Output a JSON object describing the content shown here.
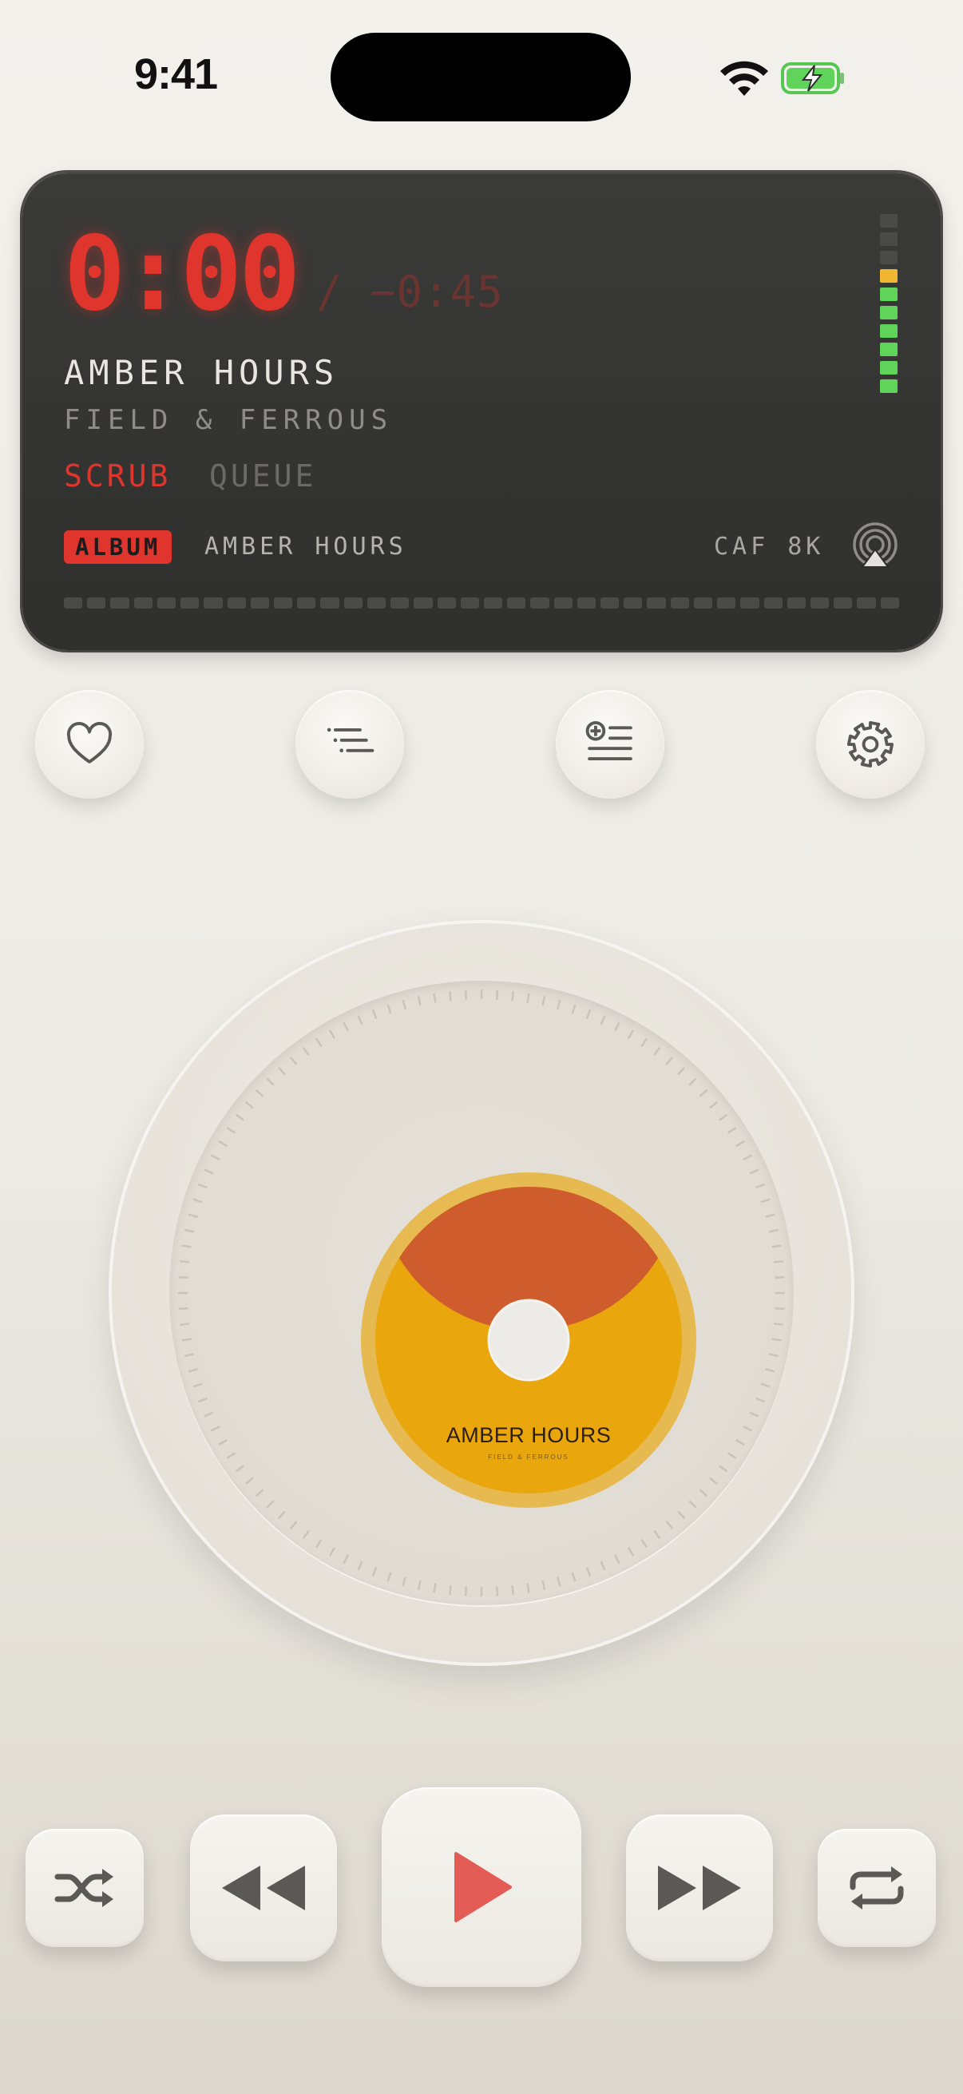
{
  "status_bar": {
    "time": "9:41",
    "wifi_icon": "wifi-icon",
    "battery_icon": "battery-charging-icon"
  },
  "display": {
    "elapsed": "0:00",
    "remaining": "/ −0:45",
    "track_title": "AMBER HOURS",
    "artist": "FIELD & FERROUS",
    "tabs": [
      {
        "label": "SCRUB",
        "active": true
      },
      {
        "label": "QUEUE",
        "active": false
      }
    ],
    "badge": "ALBUM",
    "album_name": "AMBER HOURS",
    "format": "CAF 8K",
    "output_icon": "airplay-icon",
    "level_meter": {
      "segments": 10,
      "lit_green": 6,
      "lit_yellow": 1
    },
    "progress": 0.0,
    "colors": {
      "accent": "#e0352c",
      "level_green": "#5fd35a",
      "level_yellow": "#f1b531"
    }
  },
  "actions": [
    {
      "name": "favorite",
      "icon": "heart-icon"
    },
    {
      "name": "list",
      "icon": "list-icon"
    },
    {
      "name": "add-to-queue",
      "icon": "add-to-queue-icon"
    },
    {
      "name": "settings",
      "icon": "gear-icon"
    }
  ],
  "disc": {
    "title": "AMBER HOURS",
    "subtitle": "FIELD & FERROUS",
    "colors": {
      "base": "#eaa60d",
      "top": "#cf5c2c"
    }
  },
  "transport": [
    {
      "name": "shuffle",
      "icon": "shuffle-icon"
    },
    {
      "name": "previous",
      "icon": "rewind-icon"
    },
    {
      "name": "play",
      "icon": "play-icon"
    },
    {
      "name": "next",
      "icon": "fast-forward-icon"
    },
    {
      "name": "repeat",
      "icon": "repeat-icon"
    }
  ]
}
